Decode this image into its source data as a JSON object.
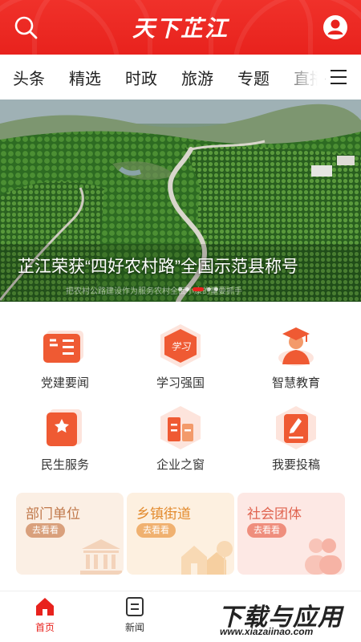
{
  "header": {
    "logo_text": "天下芷江",
    "search_icon": "search-icon",
    "user_icon": "user-icon",
    "brand_color": "#e8221d"
  },
  "nav": {
    "tabs": [
      {
        "label": "头条"
      },
      {
        "label": "精选"
      },
      {
        "label": "时政"
      },
      {
        "label": "旅游"
      },
      {
        "label": "专题"
      },
      {
        "label": "直播"
      }
    ],
    "menu_icon": "menu-icon"
  },
  "banner": {
    "title": "芷江荣获“四好农村路”全国示范县称号",
    "caption": "把农村公路建设作为服务农村全面小康的重要抓手",
    "slide_count": 5,
    "active_slide": 3
  },
  "grid": [
    {
      "label": "党建要闻",
      "icon": "party-news-icon"
    },
    {
      "label": "学习强国",
      "icon": "study-icon"
    },
    {
      "label": "智慧教育",
      "icon": "education-icon"
    },
    {
      "label": "民生服务",
      "icon": "livelihood-icon"
    },
    {
      "label": "企业之窗",
      "icon": "enterprise-icon"
    },
    {
      "label": "我要投稿",
      "icon": "submit-icon"
    }
  ],
  "cards": [
    {
      "title": "部门单位",
      "button": "去看看",
      "color": "#c0784a",
      "bg": "#fbefe4"
    },
    {
      "title": "乡镇街道",
      "button": "去看看",
      "color": "#e38a2d",
      "bg": "#fdf0e0"
    },
    {
      "title": "社会团体",
      "button": "去看看",
      "color": "#e06450",
      "bg": "#fde8e4"
    }
  ],
  "tabbar": {
    "tabs": [
      {
        "label": "首页",
        "icon": "home-icon",
        "active": true
      },
      {
        "label": "新闻",
        "icon": "news-icon",
        "active": false
      }
    ]
  },
  "watermark": {
    "big": "下载与应用",
    "small": "www.xiazaiinao.com"
  }
}
